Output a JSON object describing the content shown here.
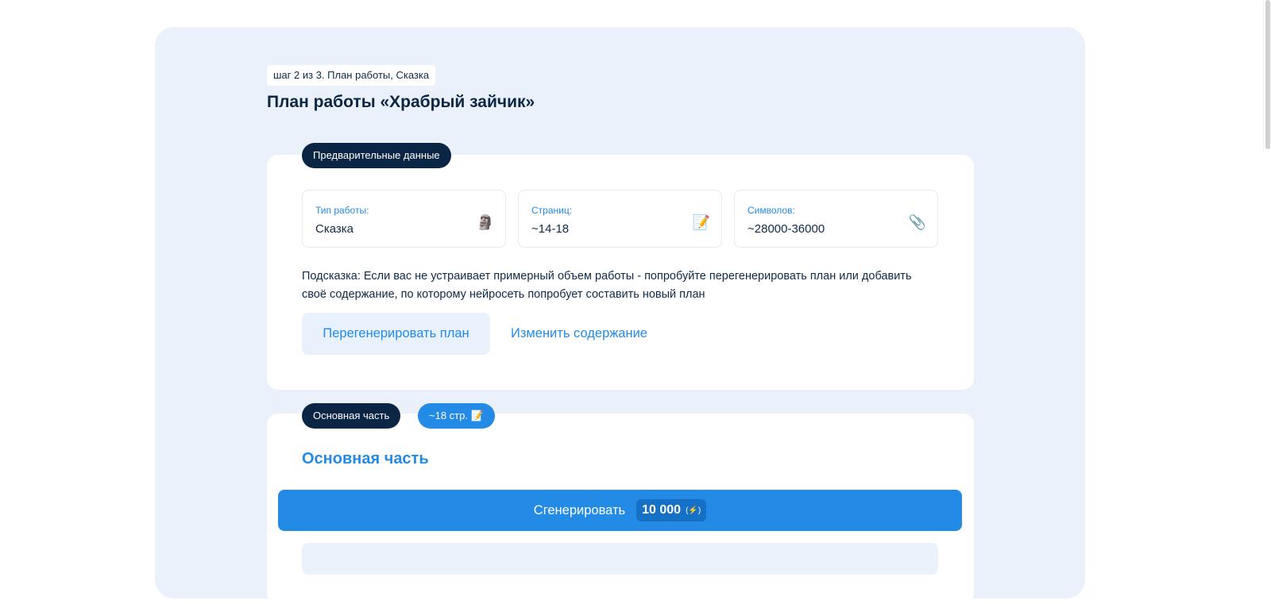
{
  "step": "шаг 2 из 3. План работы, Сказка",
  "title": "План работы «Храбрый зайчик»",
  "prelim": {
    "badge": "Предварительные данные",
    "fields": [
      {
        "label": "Тип работы:",
        "value": "Сказка",
        "icon": "moai-icon"
      },
      {
        "label": "Страниц:",
        "value": "~14-18",
        "icon": "memo-icon"
      },
      {
        "label": "Символов:",
        "value": "~28000-36000",
        "icon": "paperclip-icon"
      }
    ],
    "hint": "Подсказка: Если вас не устраивает примерный объем работы - попробуйте перегенерировать план или добавить своё содержание, по которому нейросеть попробует составить новый план",
    "regen_label": "Перегенерировать план",
    "edit_label": "Изменить содержание"
  },
  "main": {
    "badge": "Основная часть",
    "pages_badge": "~18 стр. 📝",
    "heading": "Основная часть",
    "generate_label": "Сгенерировать",
    "cost": "10 000",
    "cost_icon": "(⚡)"
  },
  "colors": {
    "accent": "#238be6",
    "dark": "#0b2545",
    "panel": "#eaf1fb"
  }
}
